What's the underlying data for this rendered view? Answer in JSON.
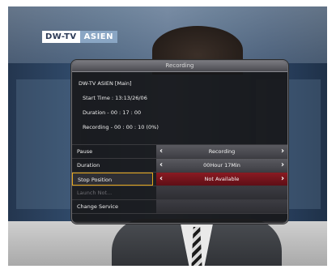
{
  "channel_logo": {
    "brand": "DW-TV",
    "region": "ASIEN"
  },
  "dialog": {
    "title": "Recording",
    "channel": "DW-TV ASIEN [Main]",
    "start_time": "Start Time : 13:13/26/06",
    "duration_info": "Duration - 00 : 17 : 00",
    "recording_info": "Recording - 00 : 00 : 10 (0%)"
  },
  "menu": {
    "pause_label": "Pause",
    "pause_value": "Recording",
    "duration_label": "Duration",
    "duration_value": "00Hour 17Min",
    "stop_label": "Stop Position",
    "stop_value": "Not Available",
    "unknown_label": "Launch Not...",
    "change_label": "Change Service"
  },
  "colors": {
    "selection_border": "#e3a51a",
    "selected_value_bg": "#8a1a22"
  }
}
